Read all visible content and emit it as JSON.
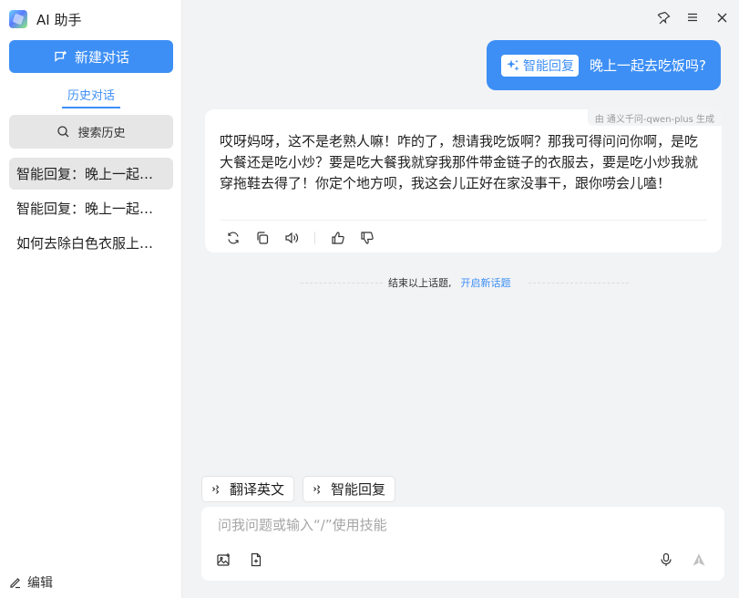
{
  "app": {
    "title": "AI 助手"
  },
  "sidebar": {
    "new_chat_label": "新建对话",
    "history_tab_label": "历史对话",
    "search_history_label": "搜索历史",
    "history_items": [
      {
        "label": "智能回复：晚上一起去吃饭吗？",
        "active": true
      },
      {
        "label": "智能回复：晚上一起去吃饭吗？",
        "active": false
      },
      {
        "label": "如何去除白色衣服上的污渍",
        "active": false
      }
    ],
    "edit_label": "编辑"
  },
  "conversation": {
    "user_message": {
      "skill_label": "智能回复",
      "text": "晚上一起去吃饭吗?"
    },
    "assistant_message": {
      "model_note": "由 通义千问-qwen-plus 生成",
      "text": "哎呀妈呀，这不是老熟人嘛！咋的了，想请我吃饭啊？那我可得问问你啊，是吃大餐还是吃小炒？要是吃大餐我就穿我那件带金链子的衣服去，要是吃小炒我就穿拖鞋去得了！你定个地方呗，我这会儿正好在家没事干，跟你唠会儿嗑！"
    },
    "topic_divider": {
      "end_text": "结束以上话题,",
      "new_topic_link": "开启新话题"
    }
  },
  "composer": {
    "skills": [
      "翻译英文",
      "智能回复"
    ],
    "placeholder": "问我问题或输入“/”使用技能",
    "value": ""
  },
  "colors": {
    "accent": "#3d8ff5",
    "sidebar_bg": "#ffffff",
    "main_bg": "#f2f3f5",
    "selected_item_bg": "#e6e6e6"
  },
  "icons": {
    "window": [
      "pin-icon",
      "menu-icon",
      "close-icon"
    ],
    "message_actions": [
      "regenerate-icon",
      "copy-icon",
      "speaker-icon",
      "thumbs-up-icon",
      "thumbs-down-icon"
    ],
    "composer": [
      "image-icon",
      "document-icon",
      "microphone-icon",
      "send-icon"
    ]
  }
}
